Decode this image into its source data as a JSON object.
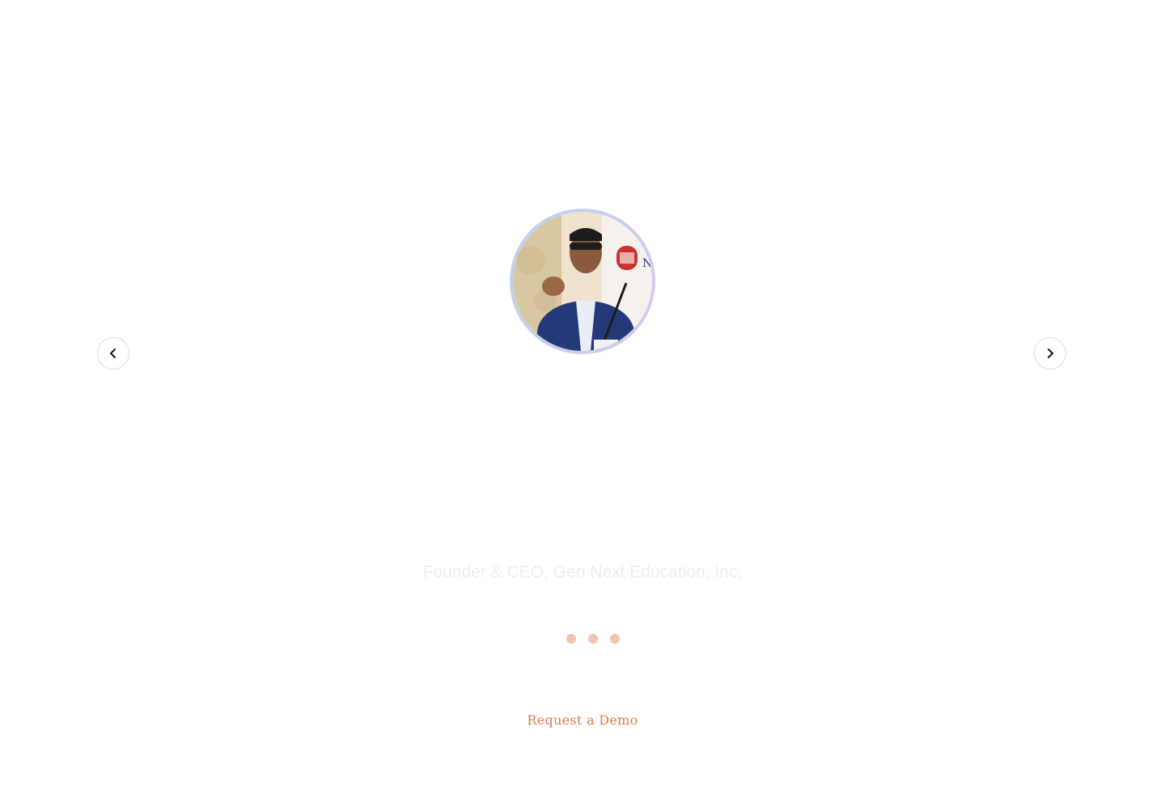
{
  "testimonial": {
    "role": "Founder & CEO, Gen Next Education, Inc.",
    "avatar_alt": "speaker-photo"
  },
  "carousel": {
    "prev_icon": "chevron-left-icon",
    "next_icon": "chevron-right-icon",
    "dot_count": 3,
    "dot_color": "#f0c3b0"
  },
  "cta": {
    "label": "Request a Demo",
    "color": "#e07a4a"
  }
}
